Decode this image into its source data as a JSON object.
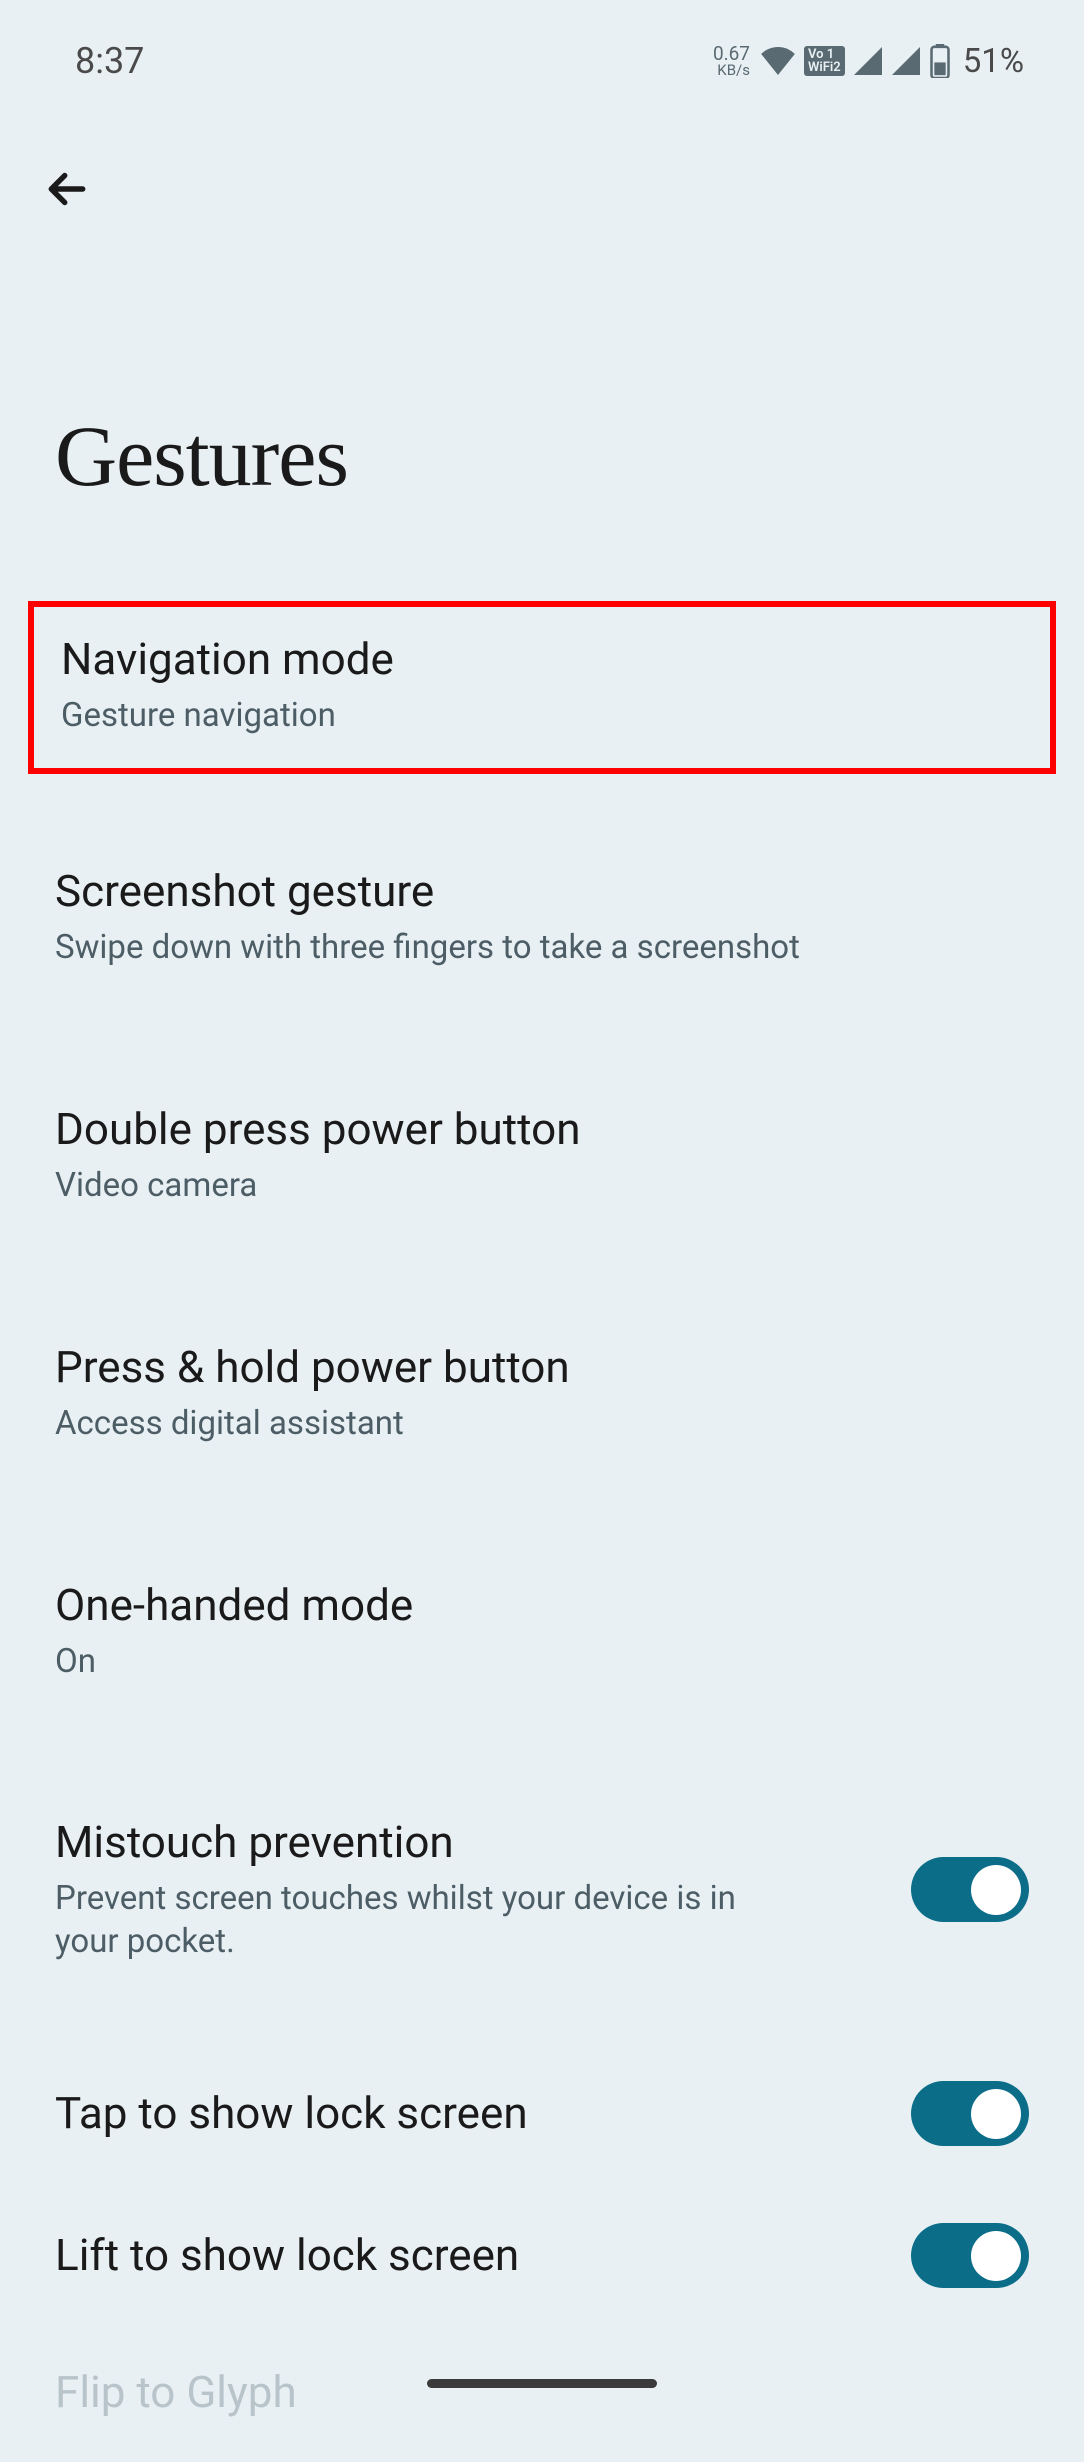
{
  "statusBar": {
    "time": "8:37",
    "dataSpeed": "0.67",
    "dataUnit": "KB/s",
    "vowifi": "Vo 1\nWiFi2",
    "battery": "51%"
  },
  "pageTitle": "Gestures",
  "settings": {
    "navigationMode": {
      "title": "Navigation mode",
      "subtitle": "Gesture navigation"
    },
    "screenshotGesture": {
      "title": "Screenshot gesture",
      "subtitle": "Swipe down with three fingers to take a screenshot"
    },
    "doublePressPower": {
      "title": "Double press power button",
      "subtitle": "Video camera"
    },
    "pressHoldPower": {
      "title": "Press & hold power button",
      "subtitle": "Access digital assistant"
    },
    "oneHandedMode": {
      "title": "One-handed mode",
      "subtitle": "On"
    },
    "mistouchPrevention": {
      "title": "Mistouch prevention",
      "subtitle": "Prevent screen touches whilst your device is in your pocket.",
      "toggle": true
    },
    "tapToShow": {
      "title": "Tap to show lock screen",
      "toggle": true
    },
    "liftToShow": {
      "title": "Lift to show lock screen",
      "toggle": true
    },
    "flipToGlyph": {
      "title": "Flip to Glyph"
    }
  }
}
